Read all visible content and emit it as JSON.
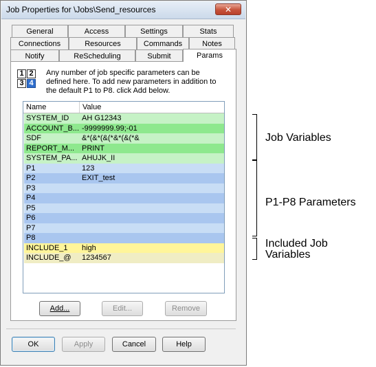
{
  "window": {
    "title": "Job Properties for \\Jobs\\Send_resources",
    "close_glyph": "✕"
  },
  "tabs": {
    "row1": [
      "General",
      "Access",
      "Settings",
      "Stats"
    ],
    "row2": [
      "Connections",
      "Resources",
      "Commands",
      "Notes"
    ],
    "row3": [
      "Notify",
      "ReScheduling",
      "Submit",
      "Params"
    ],
    "active": "Params"
  },
  "params": {
    "icon_digits": [
      "1",
      "2",
      "3",
      "4"
    ],
    "info_text": "Any number of job specific parameters can be defined here. To add new parameters in addition to the default P1 to P8. click Add below.",
    "columns": [
      "Name",
      "Value"
    ],
    "rows": [
      {
        "name": "SYSTEM_ID",
        "value": "AH G12343",
        "group": "job_var",
        "color": "#c6f2c6"
      },
      {
        "name": "ACCOUNT_B...",
        "value": "-9999999.99;-01",
        "group": "job_var",
        "color": "#8ee88e"
      },
      {
        "name": "SDF",
        "value": "&*(&*(&(*&*(&(*&",
        "group": "job_var",
        "color": "#c6f2c6"
      },
      {
        "name": "REPORT_M...",
        "value": "PRINT",
        "group": "job_var",
        "color": "#8ee88e"
      },
      {
        "name": "SYSTEM_PA...",
        "value": "AHUJK_II",
        "group": "job_var",
        "color": "#c6f2c6"
      },
      {
        "name": "P1",
        "value": "123",
        "group": "p_param",
        "color": "#c8ddf5"
      },
      {
        "name": "P2",
        "value": "EXIT_test",
        "group": "p_param",
        "color": "#a9c6ef"
      },
      {
        "name": "P3",
        "value": "",
        "group": "p_param",
        "color": "#c8ddf5"
      },
      {
        "name": "P4",
        "value": "",
        "group": "p_param",
        "color": "#a9c6ef"
      },
      {
        "name": "P5",
        "value": "",
        "group": "p_param",
        "color": "#c8ddf5"
      },
      {
        "name": "P6",
        "value": "",
        "group": "p_param",
        "color": "#a9c6ef"
      },
      {
        "name": "P7",
        "value": "",
        "group": "p_param",
        "color": "#c8ddf5"
      },
      {
        "name": "P8",
        "value": "",
        "group": "p_param",
        "color": "#a9c6ef"
      },
      {
        "name": "INCLUDE_1",
        "value": "high",
        "group": "include",
        "color": "#fff59a"
      },
      {
        "name": "INCLUDE_@",
        "value": "1234567",
        "group": "include",
        "color": "#f0edc4"
      }
    ],
    "add_label": "Add...",
    "edit_label": "Edit...",
    "remove_label": "Remove"
  },
  "footer": {
    "ok_label": "OK",
    "apply_label": "Apply",
    "cancel_label": "Cancel",
    "help_label": "Help"
  },
  "annotations": {
    "job_variables": "Job Variables",
    "p_parameters": "P1-P8 Parameters",
    "included_line1": "Included Job",
    "included_line2": "Variables"
  }
}
